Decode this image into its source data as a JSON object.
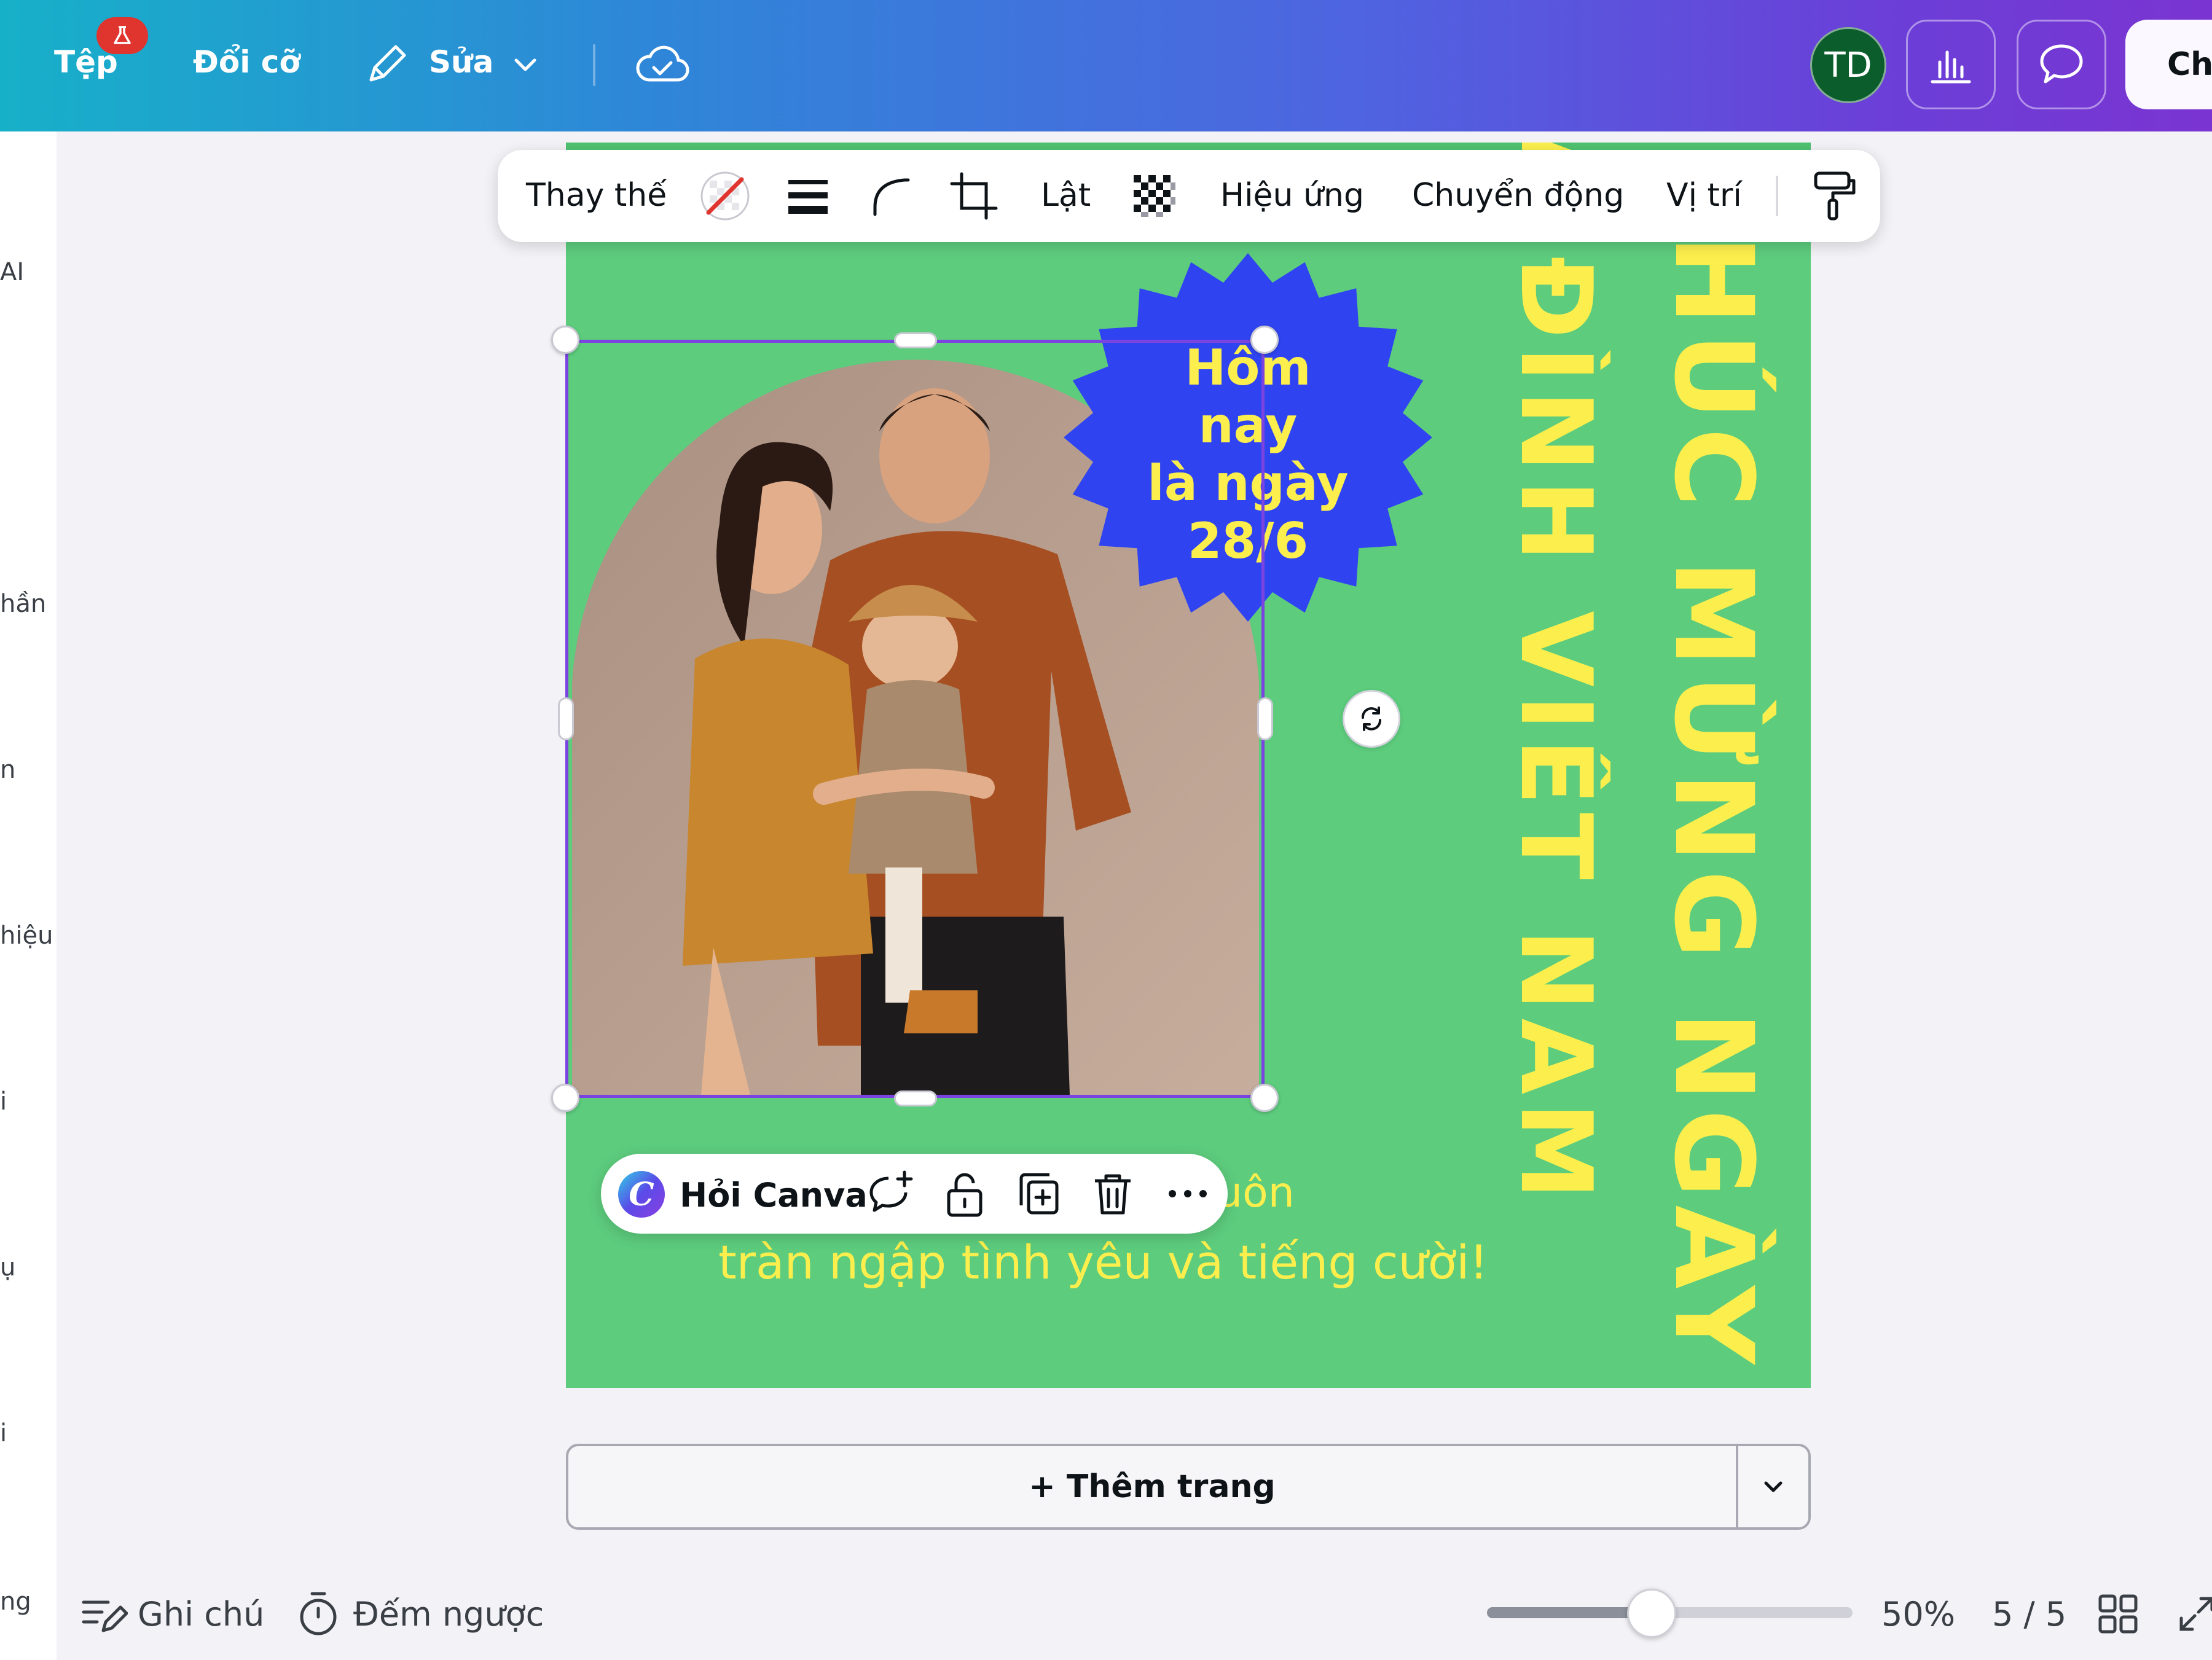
{
  "topbar": {
    "file": "Tệp",
    "resize": "Đổi cỡ",
    "edit": "Sửa",
    "avatar_initials": "TD",
    "share_label": "Chi"
  },
  "left_panel": {
    "fragments": [
      "AI",
      "hần",
      "n",
      "hiệu",
      "i",
      "ụ",
      "i",
      "ng"
    ]
  },
  "context_toolbar": {
    "replace": "Thay thế",
    "flip": "Lật",
    "effects": "Hiệu ứng",
    "animate": "Chuyển động",
    "position": "Vị trí"
  },
  "design": {
    "vertical_line1": "HÚC MỪNG NGÀY",
    "vertical_line2": "IA ĐÌNH VIỆT NAM",
    "burst_line1": "Hôm nay",
    "burst_line2": "là ngày",
    "burst_line3": "28/6",
    "body_line1": "uôn",
    "body_line2": "tràn ngập tình yêu và tiếng cười!"
  },
  "ask_bar": {
    "ask_label": "Hỏi Canva"
  },
  "add_page": {
    "label": "+ Thêm trang"
  },
  "bottom": {
    "notes": "Ghi chú",
    "timer": "Đếm ngược",
    "zoom": "50%",
    "zoom_level": 0.45,
    "pages": "5 / 5"
  },
  "colors": {
    "page_bg": "#5dcc7d",
    "accent_yellow": "#fcef4d",
    "burst_blue": "#2f44f0",
    "selection": "#7b44e0"
  }
}
